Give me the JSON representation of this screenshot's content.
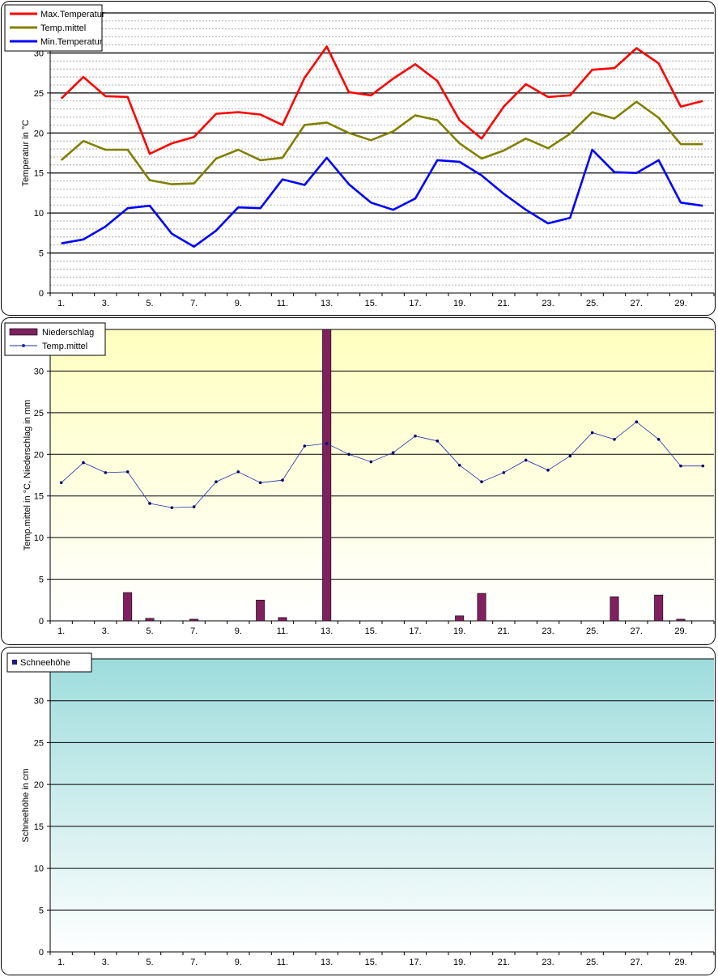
{
  "charts": {
    "temperature": {
      "type": "line",
      "ylabel": "Temperatur  in °C",
      "ylim": [
        0,
        35
      ],
      "yticks": [
        0,
        5,
        10,
        15,
        20,
        25,
        30
      ],
      "xticks": [
        "1.",
        "3.",
        "5.",
        "7.",
        "9.",
        "11.",
        "13.",
        "15.",
        "17.",
        "19.",
        "21.",
        "23.",
        "25.",
        "27.",
        "29."
      ],
      "legend_position": "top-left",
      "series": [
        {
          "name": "Max.Temperatur",
          "color": "#ff0000",
          "values": [
            24.3,
            27.0,
            24.6,
            24.5,
            17.4,
            18.7,
            19.5,
            22.4,
            22.6,
            22.3,
            21.0,
            26.9,
            30.8,
            25.1,
            24.7,
            26.8,
            28.6,
            26.5,
            21.6,
            19.3,
            23.3,
            26.1,
            24.5,
            24.7,
            27.9,
            28.1,
            30.6,
            28.7,
            23.3,
            24.0
          ]
        },
        {
          "name": "Temp.mittel",
          "color": "#808000",
          "values": [
            16.6,
            19.0,
            17.9,
            17.9,
            14.1,
            13.6,
            13.7,
            16.8,
            17.9,
            16.6,
            16.9,
            21.0,
            21.3,
            20.0,
            19.1,
            20.2,
            22.2,
            21.6,
            18.7,
            16.8,
            17.8,
            19.3,
            18.1,
            19.9,
            22.6,
            21.8,
            23.9,
            21.9,
            18.6,
            18.6
          ]
        },
        {
          "name": "Min.Temperatur",
          "color": "#0000ff",
          "values": [
            6.2,
            6.7,
            8.3,
            10.6,
            10.9,
            7.4,
            5.8,
            7.8,
            10.7,
            10.6,
            14.2,
            13.5,
            16.9,
            13.6,
            11.3,
            10.4,
            11.8,
            16.6,
            16.4,
            14.7,
            12.4,
            10.4,
            8.7,
            9.4,
            17.9,
            15.1,
            15.0,
            16.6,
            11.3,
            10.9
          ]
        }
      ]
    },
    "precipitation": {
      "type": "bar",
      "ylabel": "Temp.mittel  in °C, Niederschlag in mm",
      "ylim": [
        0,
        35
      ],
      "yticks": [
        0,
        5,
        10,
        15,
        20,
        25,
        30
      ],
      "xticks": [
        "1.",
        "3.",
        "5.",
        "7.",
        "9.",
        "11.",
        "13.",
        "15.",
        "17.",
        "19.",
        "21.",
        "23.",
        "25.",
        "27.",
        "29."
      ],
      "legend_position": "top-left",
      "bar_series": {
        "name": "Niederschlag",
        "color": "#80205e",
        "values": [
          0,
          0,
          0,
          3.4,
          0.3,
          0,
          0.2,
          0,
          0,
          2.5,
          0.4,
          0,
          35,
          0,
          0,
          0,
          0,
          0,
          0.6,
          3.3,
          0,
          0,
          0,
          0,
          0,
          2.9,
          0,
          3.1,
          0.2,
          0
        ]
      },
      "line_series": {
        "name": "Temp.mittel",
        "color": "#1f2fb0",
        "values": [
          16.6,
          19.0,
          17.8,
          17.9,
          14.1,
          13.6,
          13.7,
          16.7,
          17.9,
          16.6,
          16.9,
          21.0,
          21.3,
          20.0,
          19.1,
          20.2,
          22.2,
          21.6,
          18.7,
          16.7,
          17.8,
          19.3,
          18.1,
          19.8,
          22.6,
          21.8,
          23.9,
          21.8,
          18.6,
          18.6
        ]
      }
    },
    "snow": {
      "type": "bar",
      "ylabel": "Schneehöhe in cm",
      "ylim": [
        0,
        35
      ],
      "yticks": [
        0,
        5,
        10,
        15,
        20,
        25,
        30
      ],
      "xticks": [
        "1.",
        "3.",
        "5.",
        "7.",
        "9.",
        "11.",
        "13.",
        "15.",
        "17.",
        "19.",
        "21.",
        "23.",
        "25.",
        "27.",
        "29."
      ],
      "legend_position": "top-left",
      "bar_series": {
        "name": "Schneehöhe",
        "color": "#1a1a80",
        "values": [
          0,
          0,
          0,
          0,
          0,
          0,
          0,
          0,
          0,
          0,
          0,
          0,
          0,
          0,
          0,
          0,
          0,
          0,
          0,
          0,
          0,
          0,
          0,
          0,
          0,
          0,
          0,
          0,
          0,
          0
        ]
      }
    }
  },
  "chart_data": [
    {
      "type": "line",
      "title": "",
      "ylabel": "Temperatur  in °C",
      "ylim": [
        0,
        35
      ],
      "x": [
        1,
        2,
        3,
        4,
        5,
        6,
        7,
        8,
        9,
        10,
        11,
        12,
        13,
        14,
        15,
        16,
        17,
        18,
        19,
        20,
        21,
        22,
        23,
        24,
        25,
        26,
        27,
        28,
        29,
        30
      ],
      "series": [
        {
          "name": "Max.Temperatur",
          "values": [
            24.3,
            27.0,
            24.6,
            24.5,
            17.4,
            18.7,
            19.5,
            22.4,
            22.6,
            22.3,
            21.0,
            26.9,
            30.8,
            25.1,
            24.7,
            26.8,
            28.6,
            26.5,
            21.6,
            19.3,
            23.3,
            26.1,
            24.5,
            24.7,
            27.9,
            28.1,
            30.6,
            28.7,
            23.3,
            24.0
          ]
        },
        {
          "name": "Temp.mittel",
          "values": [
            16.6,
            19.0,
            17.9,
            17.9,
            14.1,
            13.6,
            13.7,
            16.8,
            17.9,
            16.6,
            16.9,
            21.0,
            21.3,
            20.0,
            19.1,
            20.2,
            22.2,
            21.6,
            18.7,
            16.8,
            17.8,
            19.3,
            18.1,
            19.9,
            22.6,
            21.8,
            23.9,
            21.9,
            18.6,
            18.6
          ]
        },
        {
          "name": "Min.Temperatur",
          "values": [
            6.2,
            6.7,
            8.3,
            10.6,
            10.9,
            7.4,
            5.8,
            7.8,
            10.7,
            10.6,
            14.2,
            13.5,
            16.9,
            13.6,
            11.3,
            10.4,
            11.8,
            16.6,
            16.4,
            14.7,
            12.4,
            10.4,
            8.7,
            9.4,
            17.9,
            15.1,
            15.0,
            16.6,
            11.3,
            10.9
          ]
        }
      ]
    },
    {
      "type": "bar",
      "title": "",
      "ylabel": "Temp.mittel  in °C, Niederschlag in mm",
      "ylim": [
        0,
        35
      ],
      "x": [
        1,
        2,
        3,
        4,
        5,
        6,
        7,
        8,
        9,
        10,
        11,
        12,
        13,
        14,
        15,
        16,
        17,
        18,
        19,
        20,
        21,
        22,
        23,
        24,
        25,
        26,
        27,
        28,
        29,
        30
      ],
      "series": [
        {
          "name": "Niederschlag",
          "values": [
            0,
            0,
            0,
            3.4,
            0.3,
            0,
            0.2,
            0,
            0,
            2.5,
            0.4,
            0,
            35,
            0,
            0,
            0,
            0,
            0,
            0.6,
            3.3,
            0,
            0,
            0,
            0,
            0,
            2.9,
            0,
            3.1,
            0.2,
            0
          ]
        },
        {
          "name": "Temp.mittel",
          "values": [
            16.6,
            19.0,
            17.8,
            17.9,
            14.1,
            13.6,
            13.7,
            16.7,
            17.9,
            16.6,
            16.9,
            21.0,
            21.3,
            20.0,
            19.1,
            20.2,
            22.2,
            21.6,
            18.7,
            16.7,
            17.8,
            19.3,
            18.1,
            19.8,
            22.6,
            21.8,
            23.9,
            21.8,
            18.6,
            18.6
          ]
        }
      ]
    },
    {
      "type": "bar",
      "title": "",
      "ylabel": "Schneehöhe in cm",
      "ylim": [
        0,
        35
      ],
      "x": [
        1,
        2,
        3,
        4,
        5,
        6,
        7,
        8,
        9,
        10,
        11,
        12,
        13,
        14,
        15,
        16,
        17,
        18,
        19,
        20,
        21,
        22,
        23,
        24,
        25,
        26,
        27,
        28,
        29,
        30
      ],
      "series": [
        {
          "name": "Schneehöhe",
          "values": [
            0,
            0,
            0,
            0,
            0,
            0,
            0,
            0,
            0,
            0,
            0,
            0,
            0,
            0,
            0,
            0,
            0,
            0,
            0,
            0,
            0,
            0,
            0,
            0,
            0,
            0,
            0,
            0,
            0,
            0
          ]
        }
      ]
    }
  ]
}
